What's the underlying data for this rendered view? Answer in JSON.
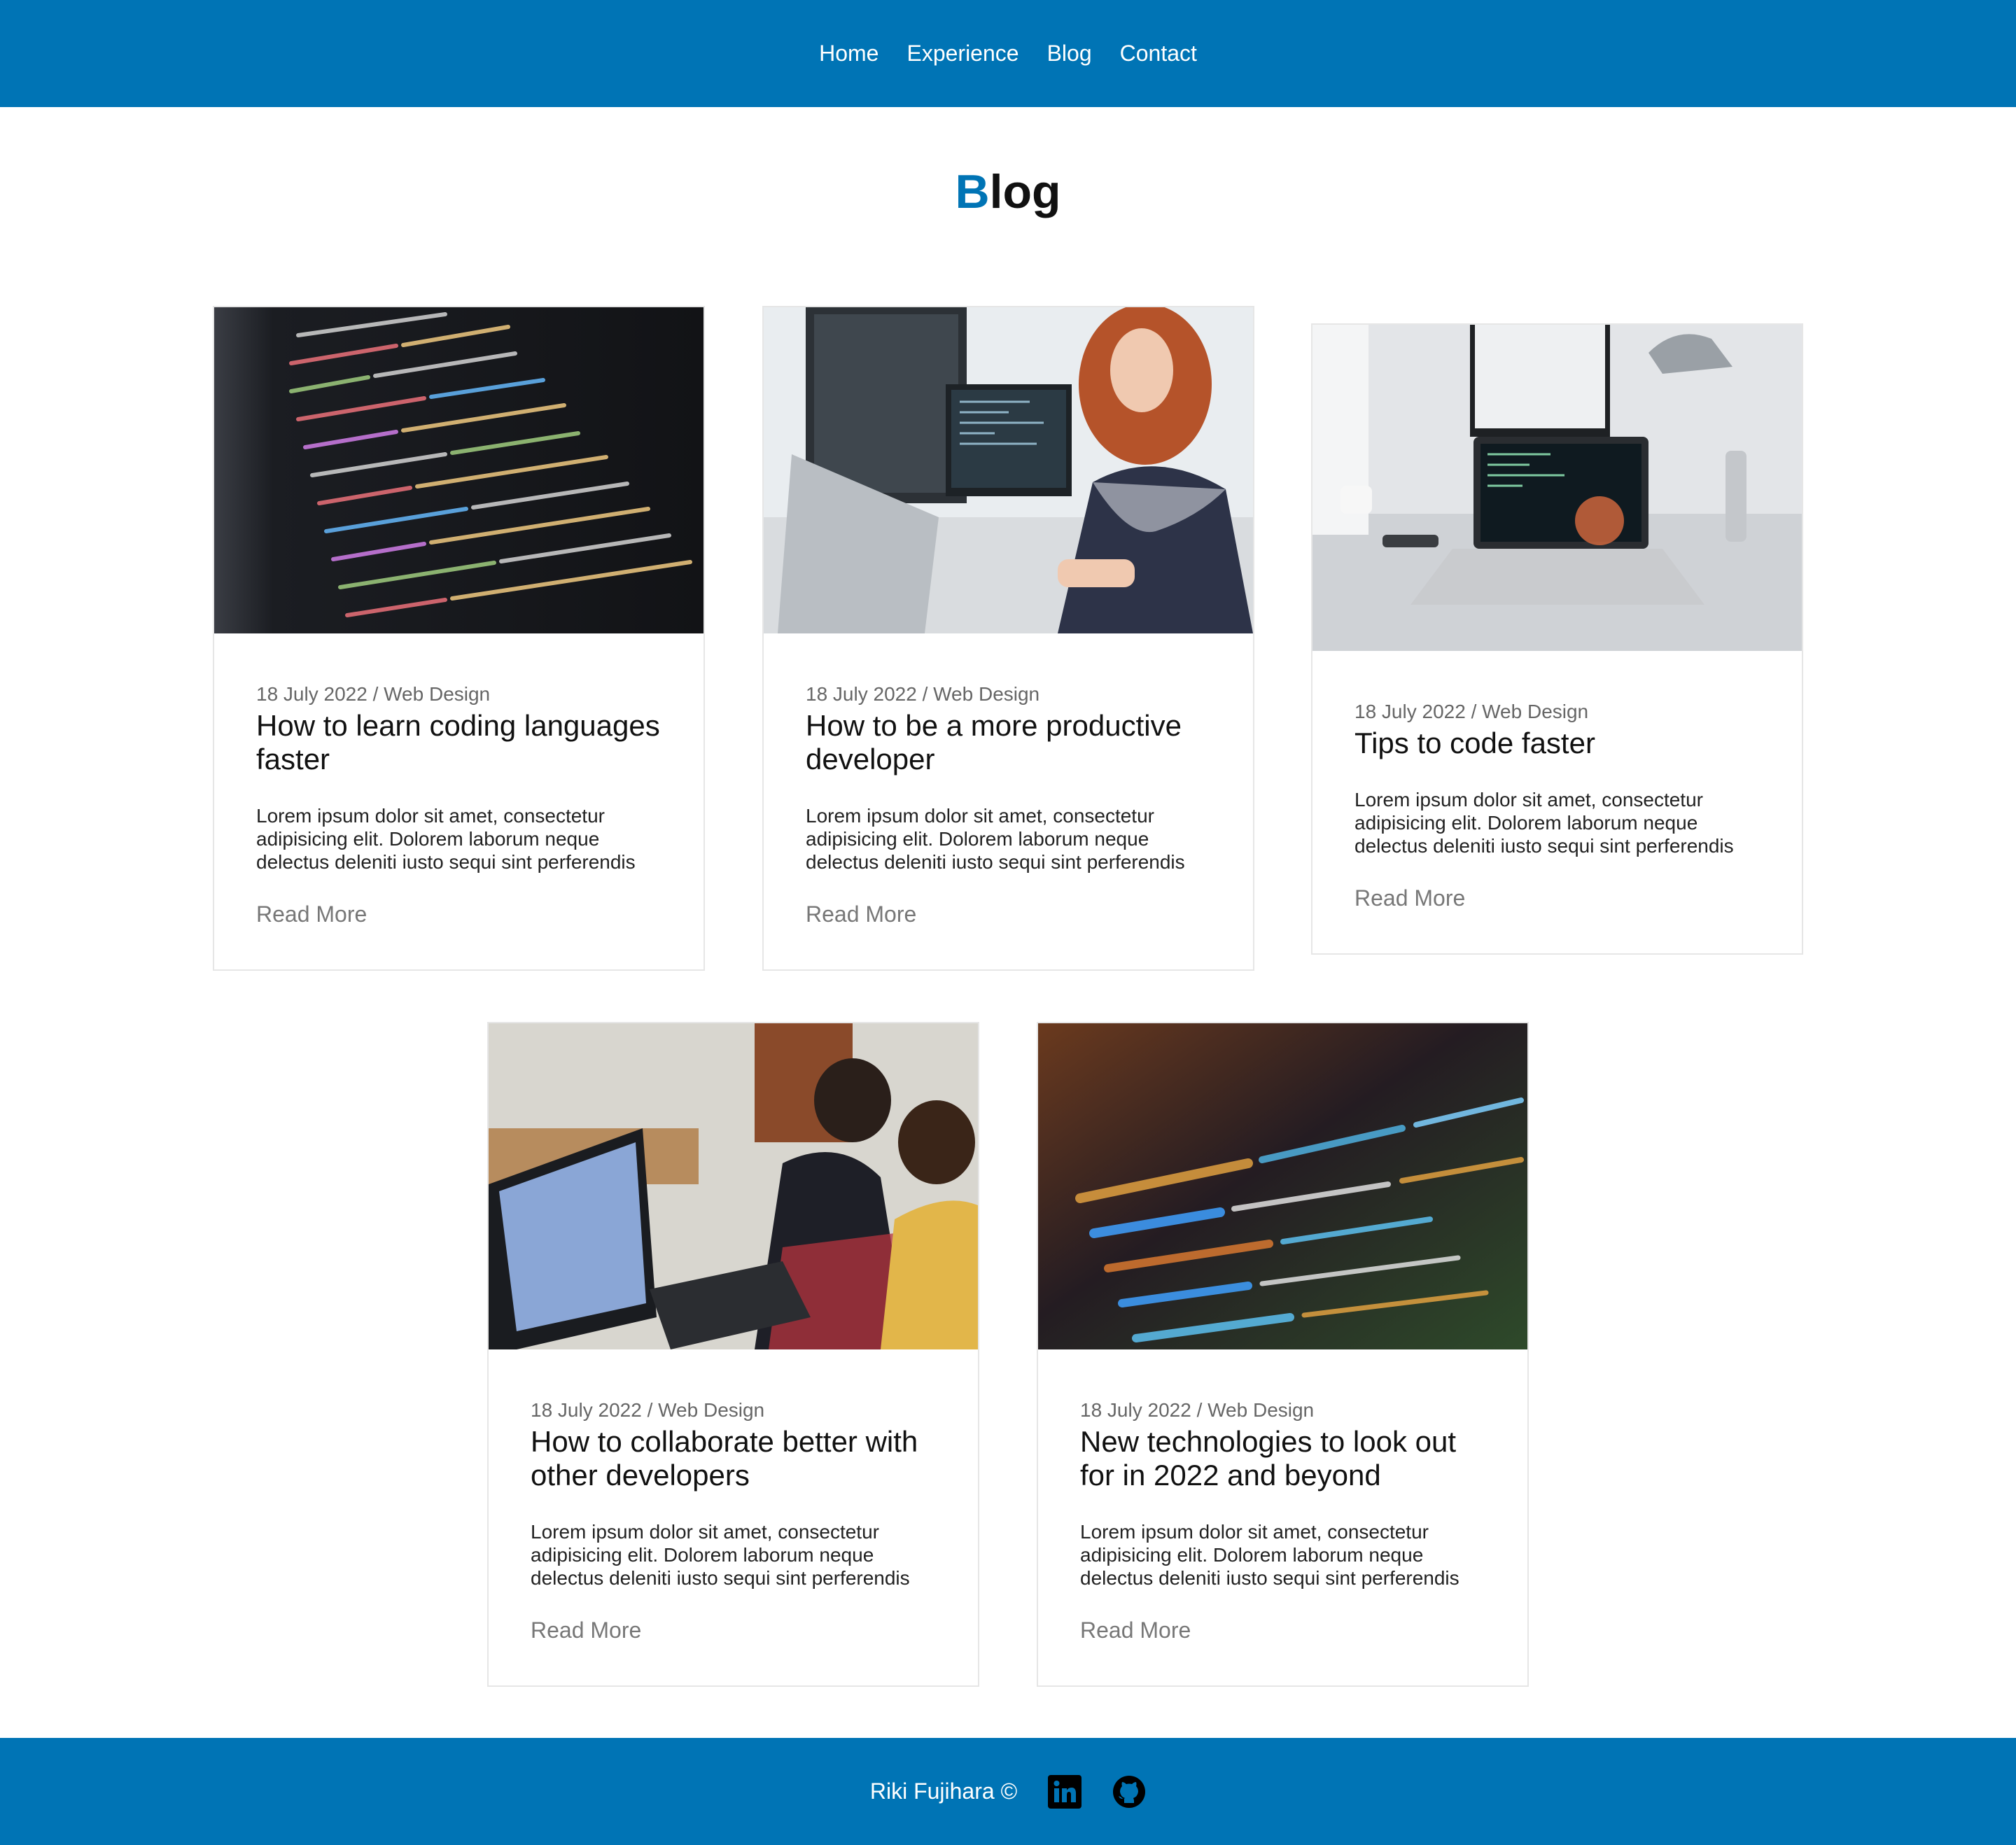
{
  "nav": {
    "items": [
      "Home",
      "Experience",
      "Blog",
      "Contact"
    ]
  },
  "page": {
    "title_accent": "B",
    "title_rest": "log"
  },
  "posts": [
    {
      "image": "code-editor-closeup",
      "meta": "18 July 2022 / Web Design",
      "title": "How to learn coding languages faster",
      "excerpt": "Lorem ipsum dolor sit amet, consectetur adipisicing elit. Dolorem laborum neque delectus deleniti iusto sequi sint perferendis",
      "link": "Read More"
    },
    {
      "image": "developer-at-desk",
      "meta": "18 July 2022 / Web Design",
      "title": "How to be a more productive developer",
      "excerpt": "Lorem ipsum dolor sit amet, consectetur adipisicing elit. Dolorem laborum neque delectus deleniti iusto sequi sint perferendis",
      "link": "Read More"
    },
    {
      "image": "laptop-on-desk",
      "meta": "18 July 2022 / Web Design",
      "title": "Tips to code faster",
      "excerpt": "Lorem ipsum dolor sit amet, consectetur adipisicing elit. Dolorem laborum neque delectus deleniti iusto sequi sint perferendis",
      "link": "Read More"
    },
    {
      "image": "developers-collaborating",
      "meta": "18 July 2022 / Web Design",
      "title": "How to collaborate better with other developers",
      "excerpt": "Lorem ipsum dolor sit amet, consectetur adipisicing elit. Dolorem laborum neque delectus deleniti iusto sequi sint perferendis",
      "link": "Read More"
    },
    {
      "image": "blurred-code-screen",
      "meta": "18 July 2022 / Web Design",
      "title": "New technologies to look out for in 2022 and beyond",
      "excerpt": "Lorem ipsum dolor sit amet, consectetur adipisicing elit. Dolorem laborum neque delectus deleniti iusto sequi sint perferendis",
      "link": "Read More"
    }
  ],
  "footer": {
    "text": "Riki Fujihara ©",
    "icons": [
      "linkedin-icon",
      "github-icon"
    ]
  },
  "colors": {
    "brand": "#0074b5",
    "meta_text": "#666666",
    "link_text": "#777777"
  }
}
